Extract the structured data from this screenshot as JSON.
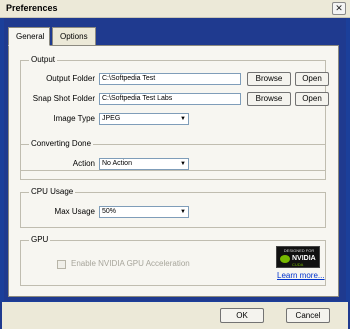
{
  "window": {
    "title": "Preferences",
    "close_symbol": "✕"
  },
  "tabs": [
    {
      "label": "General",
      "active": true
    },
    {
      "label": "Options",
      "active": false
    }
  ],
  "output": {
    "title": "Output",
    "output_folder_label": "Output Folder",
    "output_folder_value": "C:\\Softpedia Test",
    "snapshot_folder_label": "Snap Shot Folder",
    "snapshot_folder_value": "C:\\Softpedia Test Labs",
    "browse_label": "Browse",
    "open_label": "Open",
    "image_type_label": "Image Type",
    "image_type_value": "JPEG"
  },
  "converting": {
    "title": "Converting Done",
    "action_label": "Action",
    "action_value": "No Action"
  },
  "cpu": {
    "title": "CPU Usage",
    "max_usage_label": "Max Usage",
    "max_usage_value": "50%"
  },
  "gpu": {
    "title": "GPU",
    "checkbox_label": "Enable NVIDIA GPU Acceleration",
    "checked": false,
    "badge_top": "DESIGNED FOR",
    "badge_name": "NVIDIA",
    "badge_sub": "CUDA",
    "learn_more": "Learn more..."
  },
  "footer": {
    "ok_label": "OK",
    "cancel_label": "Cancel"
  },
  "colors": {
    "accent_blue": "#1f3a8f",
    "nvidia_green": "#76b900"
  }
}
